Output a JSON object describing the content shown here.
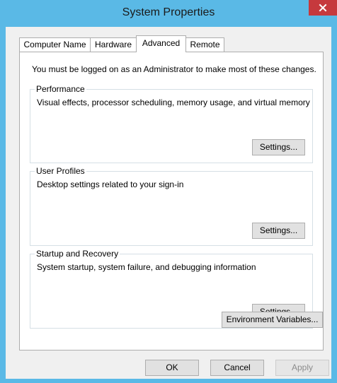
{
  "window": {
    "title": "System Properties",
    "close_glyph": "x"
  },
  "tabs": [
    {
      "label": "Computer Name",
      "active": false
    },
    {
      "label": "Hardware",
      "active": false
    },
    {
      "label": "Advanced",
      "active": true
    },
    {
      "label": "Remote",
      "active": false
    }
  ],
  "advanced": {
    "admin_notice": "You must be logged on as an Administrator to make most of these changes.",
    "performance": {
      "title": "Performance",
      "description": "Visual effects, processor scheduling, memory usage, and virtual memory",
      "button": "Settings..."
    },
    "user_profiles": {
      "title": "User Profiles",
      "description": "Desktop settings related to your sign-in",
      "button": "Settings..."
    },
    "startup_recovery": {
      "title": "Startup and Recovery",
      "description": "System startup, system failure, and debugging information",
      "button": "Settings..."
    },
    "env_button": "Environment Variables..."
  },
  "footer": {
    "ok": "OK",
    "cancel": "Cancel",
    "apply": "Apply"
  },
  "colors": {
    "frame": "#5ab9e6",
    "close": "#c6393d",
    "client": "#f0f0f0"
  }
}
